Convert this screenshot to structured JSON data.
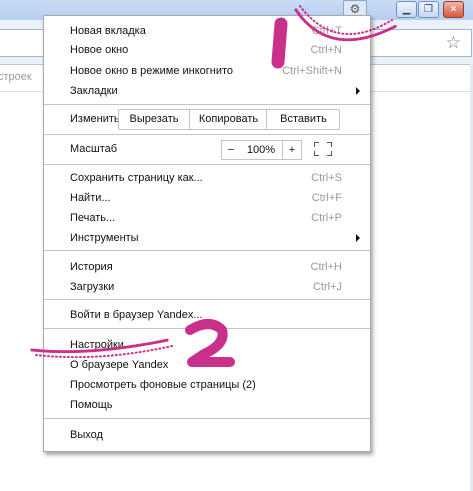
{
  "toolbar": {
    "bookmarks_partial": "строек"
  },
  "menu": {
    "new_tab": {
      "label": "Новая вкладка",
      "shortcut": "Ctrl+T"
    },
    "new_window": {
      "label": "Новое окно",
      "shortcut": "Ctrl+N"
    },
    "incognito": {
      "label": "Новое окно в режиме инкогнито",
      "shortcut": "Ctrl+Shift+N"
    },
    "bookmarks": {
      "label": "Закладки"
    },
    "edit": {
      "label": "Изменить",
      "cut": "Вырезать",
      "copy": "Копировать",
      "paste": "Вставить"
    },
    "zoom": {
      "label": "Масштаб",
      "minus": "−",
      "value": "100%",
      "plus": "+"
    },
    "save_page": {
      "label": "Сохранить страницу как...",
      "shortcut": "Ctrl+S"
    },
    "find": {
      "label": "Найти...",
      "shortcut": "Ctrl+F"
    },
    "print": {
      "label": "Печать...",
      "shortcut": "Ctrl+P"
    },
    "tools": {
      "label": "Инструменты"
    },
    "history": {
      "label": "История",
      "shortcut": "Ctrl+H"
    },
    "downloads": {
      "label": "Загрузки",
      "shortcut": "Ctrl+J"
    },
    "sign_in": {
      "label": "Войти в браузер Yandex..."
    },
    "settings": {
      "label": "Настройки"
    },
    "about": {
      "label": "О браузере Yandex"
    },
    "background_pages": {
      "label": "Просмотреть фоновые страницы (2)"
    },
    "help": {
      "label": "Помощь"
    },
    "exit": {
      "label": "Выход"
    }
  },
  "annotations": {
    "color": "#c8308a"
  }
}
